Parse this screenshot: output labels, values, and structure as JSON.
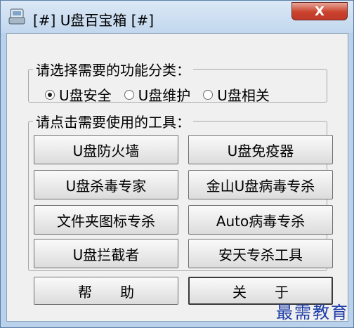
{
  "window": {
    "title": "[#] U盘百宝箱 [#]",
    "close_label": "X"
  },
  "category_group": {
    "legend": "请选择需要的功能分类：",
    "options": [
      {
        "label": "U盘安全",
        "checked": true
      },
      {
        "label": "U盘维护",
        "checked": false
      },
      {
        "label": "U盘相关",
        "checked": false
      }
    ]
  },
  "tools_group": {
    "legend": "请点击需要使用的工具：",
    "buttons": [
      "U盘防火墙",
      "U盘免疫器",
      "U盘杀毒专家",
      "金山U盘病毒专杀",
      "文件夹图标专杀",
      "Auto病毒专杀",
      "U盘拦截者",
      "安天专杀工具"
    ]
  },
  "bottom": {
    "help_label": "帮助",
    "about_label": "关于"
  },
  "watermark": "最需教育",
  "colors": {
    "window_frame": "#b9d1ea",
    "client_bg": "#f0f0f0",
    "close_red": "#c9422b",
    "watermark_blue": "#1f3ea8"
  }
}
